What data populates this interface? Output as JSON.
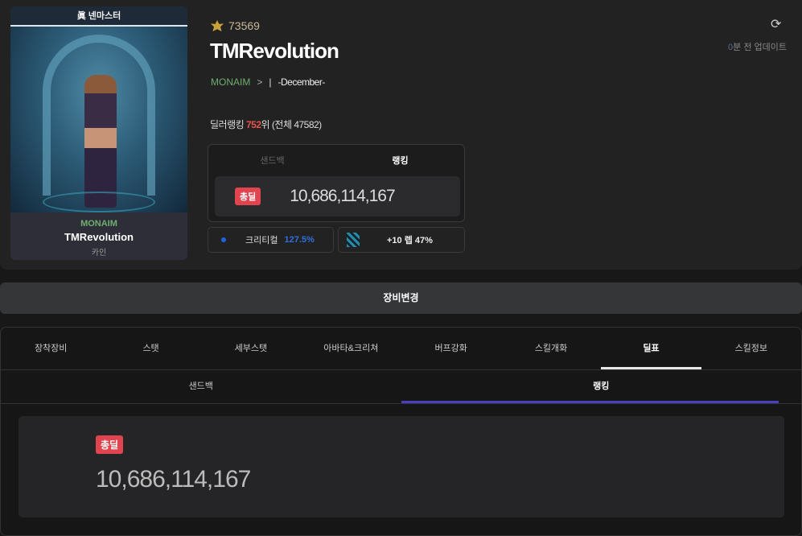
{
  "character": {
    "job": "眞 넨마스터",
    "guild": "MONAIM",
    "name": "TMRevolution",
    "server": "카인"
  },
  "profile": {
    "fame": "73569",
    "name": "TMRevolution",
    "guild": "MONAIM",
    "guild_arrow": ">",
    "separator": "|",
    "adventure": "-December-",
    "rank_prefix": "딜러랭킹 ",
    "rank": "752",
    "rank_suffix": "위 (전체 47582)"
  },
  "update": {
    "minutes": "0",
    "text": "분 전 업데이트",
    "refresh_icon": "⟳"
  },
  "damage_box": {
    "tabs": [
      "샌드백",
      "랭킹"
    ],
    "badge": "총딜",
    "value": "10,686,114,167"
  },
  "stats": {
    "crit_label": "크리티컬",
    "crit_value": "127.5%",
    "rune_text": "+10 렙 47%"
  },
  "change_button": "장비변경",
  "main_tabs": [
    "장착장비",
    "스탯",
    "세부스탯",
    "아바타&크리쳐",
    "버프강화",
    "스킬개화",
    "딜표",
    "스킬정보"
  ],
  "sub_tabs": [
    "샌드백",
    "랭킹"
  ],
  "result": {
    "badge": "총딜",
    "value": "10,686,114,167"
  },
  "colors": {
    "accent": "#4a3fc0",
    "badge": "#e0454f",
    "guild": "#6fae6f",
    "rank": "#e8534f",
    "crit": "#2f6fe0"
  }
}
